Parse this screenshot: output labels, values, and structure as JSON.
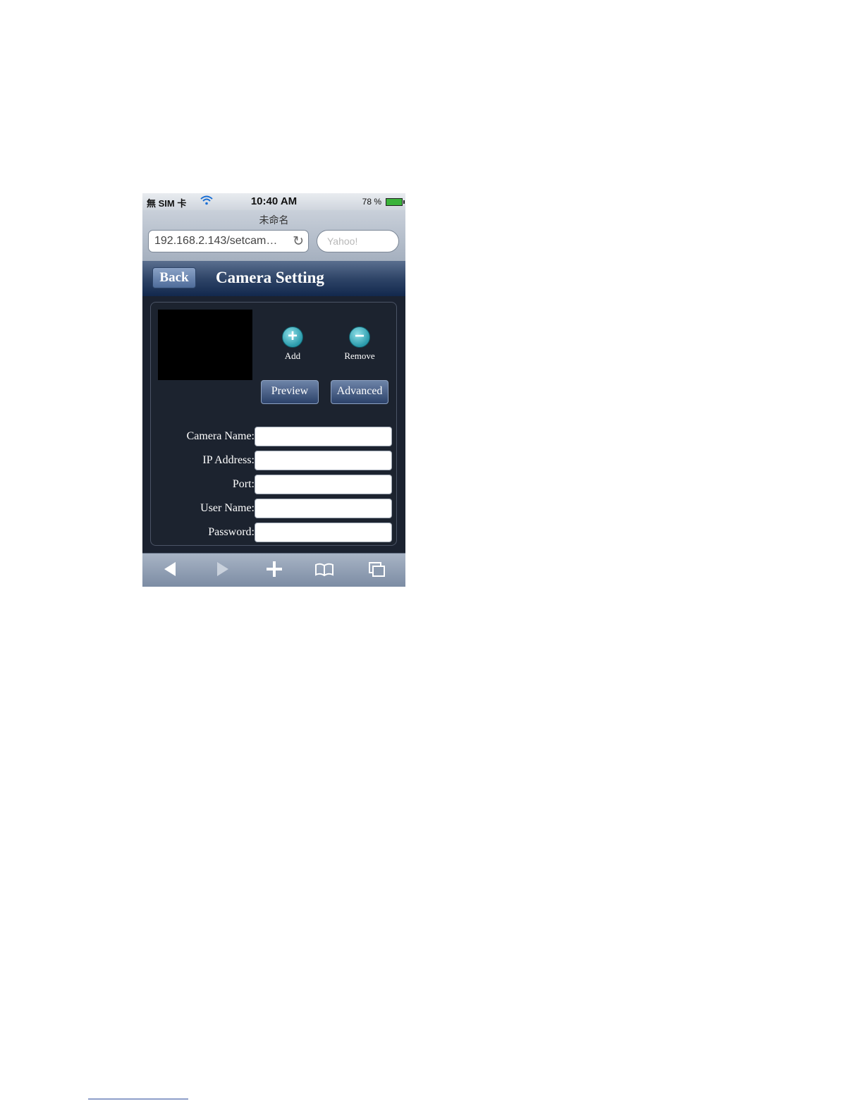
{
  "status_bar": {
    "carrier": "無 SIM 卡",
    "time": "10:40 AM",
    "battery": "78 %"
  },
  "browser": {
    "page_title": "未命名",
    "url": "192.168.2.143/setcam…",
    "search_placeholder": "Yahoo!"
  },
  "nav": {
    "back_label": "Back",
    "title": "Camera Setting"
  },
  "actions": {
    "add_label": "Add",
    "remove_label": "Remove",
    "preview_label": "Preview",
    "advanced_label": "Advanced"
  },
  "form": {
    "fields": [
      {
        "label": "Camera Name:",
        "value": ""
      },
      {
        "label": "IP Address:",
        "value": ""
      },
      {
        "label": "Port:",
        "value": ""
      },
      {
        "label": "User Name:",
        "value": ""
      },
      {
        "label": "Password:",
        "value": ""
      }
    ]
  },
  "toolbar": {
    "icons": [
      "back-arrow-icon",
      "forward-arrow-icon",
      "plus-icon",
      "bookmarks-icon",
      "pages-icon"
    ]
  },
  "colors": {
    "nav_bar": "#2f4568",
    "content_bg": "#1b2230",
    "action_circle": "#2a9aab"
  }
}
